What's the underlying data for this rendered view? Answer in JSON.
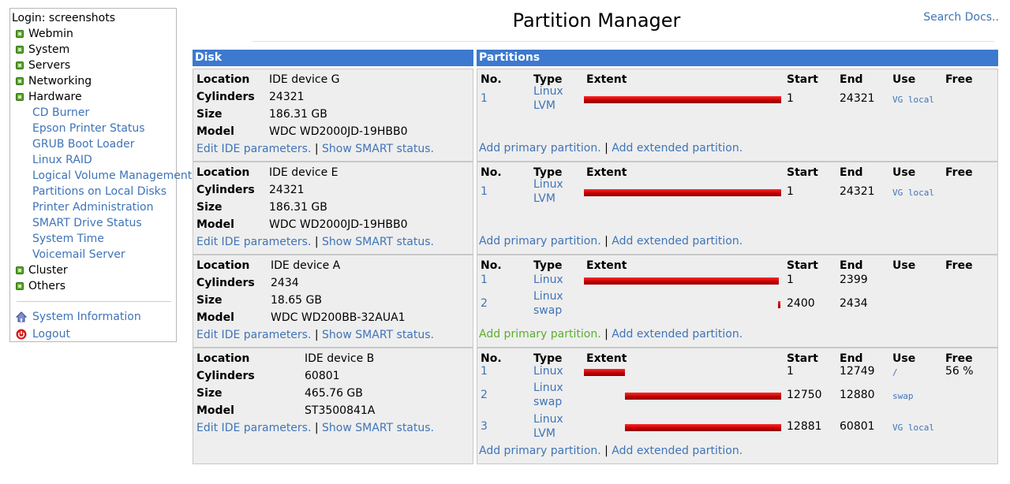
{
  "sidebar": {
    "login": "Login: screenshots",
    "categories_top": [
      "Webmin",
      "System",
      "Servers",
      "Networking",
      "Hardware"
    ],
    "hardware_items": [
      "CD Burner",
      "Epson Printer Status",
      "GRUB Boot Loader",
      "Linux RAID",
      "Logical Volume Management",
      "Partitions on Local Disks",
      "Printer Administration",
      "SMART Drive Status",
      "System Time",
      "Voicemail Server"
    ],
    "categories_bottom": [
      "Cluster",
      "Others"
    ],
    "system_information": "System Information",
    "logout": "Logout"
  },
  "header": {
    "title": "Partition Manager",
    "search": "Search Docs.."
  },
  "table": {
    "disk_header": "Disk",
    "partitions_header": "Partitions",
    "labels": {
      "location": "Location",
      "cylinders": "Cylinders",
      "size": "Size",
      "model": "Model"
    },
    "col_headers": {
      "no": "No.",
      "type": "Type",
      "extent": "Extent",
      "start": "Start",
      "end": "End",
      "use": "Use",
      "free": "Free"
    },
    "edit_ide": "Edit IDE parameters.",
    "show_smart": "Show SMART status.",
    "add_primary": "Add primary partition.",
    "add_extended": "Add extended partition.",
    "link_sep": "|",
    "disks": [
      {
        "location": "IDE device G",
        "cylinders": "24321",
        "size": "186.31 GB",
        "model": "WDC WD2000JD-19HBB0",
        "partitions": [
          {
            "no": "1",
            "type": [
              "Linux",
              "LVM"
            ],
            "start": "1",
            "end": "24321",
            "use": "VG local",
            "free": ""
          }
        ]
      },
      {
        "location": "IDE device E",
        "cylinders": "24321",
        "size": "186.31 GB",
        "model": "WDC WD2000JD-19HBB0",
        "partitions": [
          {
            "no": "1",
            "type": [
              "Linux",
              "LVM"
            ],
            "start": "1",
            "end": "24321",
            "use": "VG local",
            "free": ""
          }
        ]
      },
      {
        "location": "IDE device A",
        "cylinders": "2434",
        "size": "18.65 GB",
        "model": "WDC WD200BB-32AUA1",
        "partitions": [
          {
            "no": "1",
            "type": [
              "Linux"
            ],
            "start": "1",
            "end": "2399",
            "use": "",
            "free": ""
          },
          {
            "no": "2",
            "type": [
              "Linux",
              "swap"
            ],
            "start": "2400",
            "end": "2434",
            "use": "",
            "free": ""
          }
        ]
      },
      {
        "location": "IDE device B",
        "cylinders": "60801",
        "size": "465.76 GB",
        "model": "ST3500841A",
        "partitions": [
          {
            "no": "1",
            "type": [
              "Linux"
            ],
            "start": "1",
            "end": "12749",
            "use": "/",
            "free": "56 %"
          },
          {
            "no": "2",
            "type": [
              "Linux",
              "swap"
            ],
            "start": "12750",
            "end": "12880",
            "use": "swap",
            "free": ""
          },
          {
            "no": "3",
            "type": [
              "Linux",
              "LVM"
            ],
            "start": "12881",
            "end": "60801",
            "use": "VG local",
            "free": ""
          }
        ]
      }
    ]
  },
  "colors": {
    "header_bg": "#3c79cf",
    "link": "#3f74b8",
    "bar": "#cc0000",
    "hover_link": "#5ab02c"
  }
}
